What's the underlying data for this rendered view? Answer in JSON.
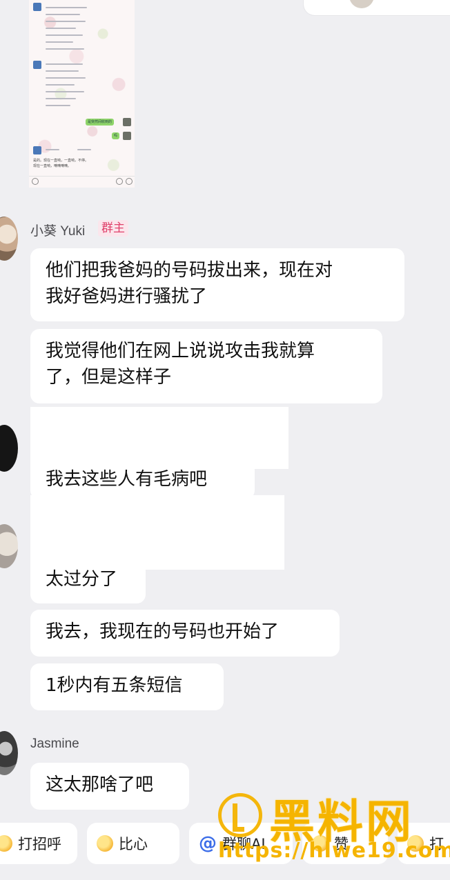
{
  "messages": {
    "yuki_group": {
      "sender": "小葵 Yuki",
      "role_badge": "群主",
      "bubbles": [
        "他们把我爸妈的号码拔出来，现在对\n我好爸妈进行骚扰了",
        "我觉得他们在网上说说攻击我就算\n了，但是这样子"
      ]
    },
    "middle": [
      "我去这些人有毛病吧",
      "太过分了",
      "我去，我现在的号码也开始了",
      "1秒内有五条短信"
    ],
    "jasmine_group": {
      "sender": "Jasmine",
      "bubbles": [
        "这太那啥了吧"
      ]
    }
  },
  "embedded_screenshot": {
    "green_bubble_text": "是突然间收到的",
    "green_bubble_short": "吗",
    "footer_text_1": "是的。现在一直响，一直响，不停。",
    "footer_text_2": "现在一直响，嘀嘀嘀嘀。"
  },
  "quick_actions": [
    {
      "icon": "wave-emoji-icon",
      "label": "打招呼"
    },
    {
      "icon": "heart-hands-emoji-icon",
      "label": "比心"
    },
    {
      "icon": "at-icon",
      "label": "群聊AI"
    },
    {
      "icon": "thumbs-up-emoji-icon",
      "label": "赞"
    },
    {
      "icon": "emoji-icon",
      "label": "打"
    }
  ],
  "watermark": {
    "brand": "黑料网",
    "url": "https://hlwe19.com"
  },
  "colors": {
    "background": "#efeff2",
    "bubble": "#ffffff",
    "badge_text": "#e0406a",
    "badge_bg": "#fbe6ec",
    "watermark": "#f5b400",
    "at_icon": "#3c6de8"
  }
}
